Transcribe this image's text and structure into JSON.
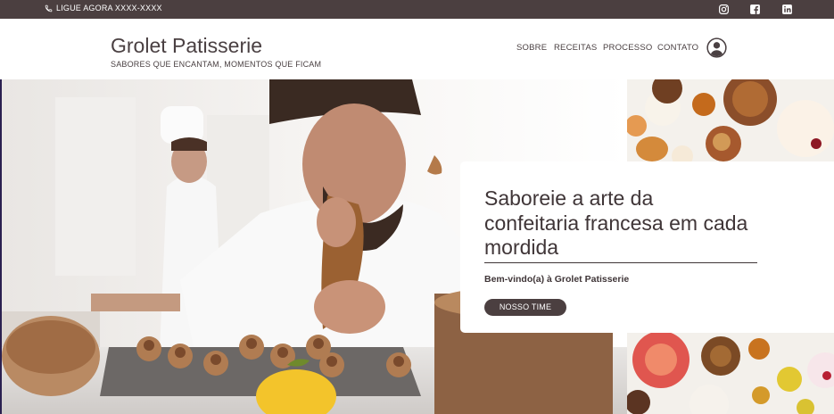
{
  "topbar": {
    "phone_text": "LIGUE AGORA XXXX-XXXX",
    "social": [
      "instagram-icon",
      "facebook-icon",
      "linkedin-icon"
    ]
  },
  "header": {
    "brand": "Grolet Patisserie",
    "tagline": "SABORES QUE ENCANTAM, MOMENTOS QUE FICAM",
    "nav": [
      "SOBRE",
      "RECEITAS",
      "PROCESSO",
      "CONTATO"
    ]
  },
  "hero": {
    "headline": "Saboreie a arte da confeitaria francesa em cada mordida",
    "welcome": "Bem-vindo(a) à Grolet Patisserie",
    "button": "NOSSO TIME"
  },
  "colors": {
    "brand_dark": "#4b3f40",
    "text": "#3f3537",
    "background": "#ffffff"
  }
}
